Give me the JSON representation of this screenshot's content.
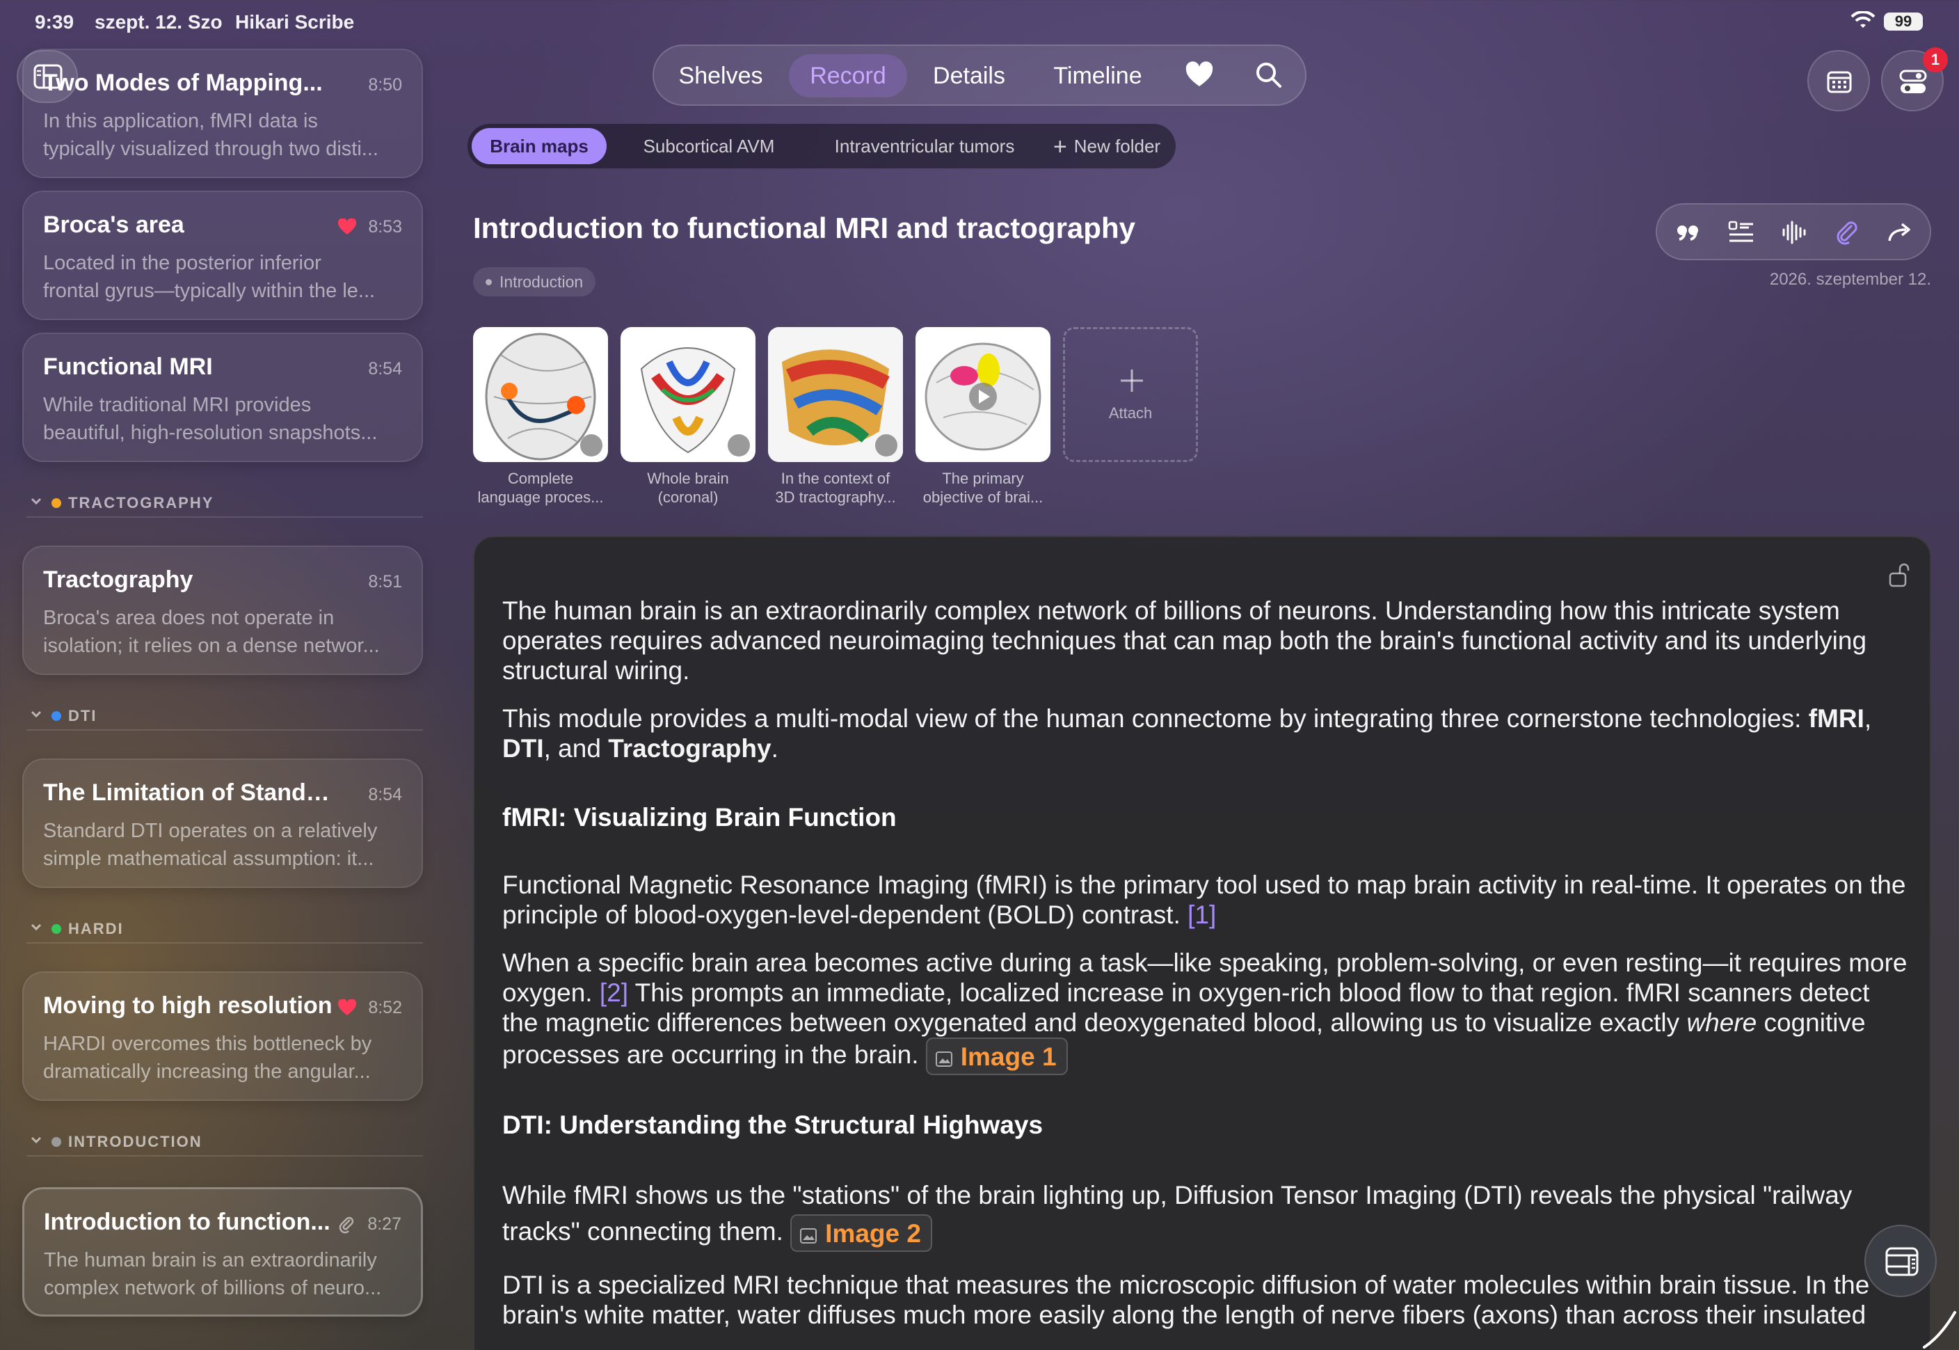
{
  "status": {
    "time": "9:39",
    "date": "szept. 12. Szo",
    "app": "Hikari Scribe",
    "battery": "99"
  },
  "nav": {
    "tabs": [
      "Shelves",
      "Record",
      "Details",
      "Timeline"
    ],
    "active_tab": "Record",
    "notification_count": "1"
  },
  "folders": {
    "items": [
      "Brain maps",
      "Subcortical AVM",
      "Intraventricular tumors"
    ],
    "active": "Brain maps",
    "new_folder": "New folder"
  },
  "sidebar": {
    "cards": [
      {
        "title": "Two Modes of Mapping...",
        "time": "8:50",
        "line1": "In this application, fMRI data is",
        "line2": "typically visualized through two disti...",
        "favorite": false
      },
      {
        "title": "Broca's area",
        "time": "8:53",
        "line1": "Located in the posterior inferior",
        "line2": "frontal gyrus—typically within the le...",
        "favorite": true
      },
      {
        "title": "Functional MRI",
        "time": "8:54",
        "line1": "While traditional MRI provides",
        "line2": "beautiful, high-resolution snapshots...",
        "favorite": false
      },
      {
        "title": "Tractography",
        "time": "8:51",
        "line1": "Broca's area does not operate in",
        "line2": "isolation; it relies on a dense networ...",
        "favorite": false
      },
      {
        "title": "The Limitation of Standar...",
        "time": "8:54",
        "line1": "Standard DTI operates on a relatively",
        "line2": "simple mathematical assumption: it...",
        "favorite": false
      },
      {
        "title": "Moving to high resolution",
        "time": "8:52",
        "line1": "HARDI overcomes this bottleneck by",
        "line2": "dramatically increasing the angular...",
        "favorite": true
      },
      {
        "title": "Introduction to function...",
        "time": "8:27",
        "line1": "The human brain is an extraordinarily",
        "line2": "complex network of billions of neuro...",
        "favorite": false,
        "attachment": true
      }
    ],
    "sections": [
      {
        "label": "TRACTOGRAPHY",
        "color": "#f5a623"
      },
      {
        "label": "DTI",
        "color": "#3b8cf5"
      },
      {
        "label": "HARDI",
        "color": "#34c759"
      },
      {
        "label": "INTRODUCTION",
        "color": "#9a9a9a"
      }
    ]
  },
  "note": {
    "title": "Introduction to functional MRI and tractography",
    "tag": "Introduction",
    "date": "2026. szeptember 12.",
    "attachments": [
      {
        "cap1": "Complete",
        "cap2": "language proces..."
      },
      {
        "cap1": "Whole brain",
        "cap2": "(coronal)"
      },
      {
        "cap1": "In the context of",
        "cap2": "3D tractography..."
      },
      {
        "cap1": "The primary",
        "cap2": "objective of brai..."
      }
    ],
    "attach_label": "Attach",
    "body": {
      "p1": "The human brain is an extraordinarily complex network of billions of neurons. Understanding how this intricate system operates requires advanced neuroimaging techniques that can map both the brain's functional activity and its underlying structural wiring.",
      "p2_a": "This module provides a multi-modal view of the human connectome by integrating three cornerstone technologies: ",
      "p2_b1": "fMRI",
      "p2_c": ", ",
      "p2_b2": "DTI",
      "p2_d": ", and ",
      "p2_b3": "Tractography",
      "p2_e": ".",
      "h1": "fMRI: Visualizing Brain Function",
      "p3": "Functional Magnetic Resonance Imaging (fMRI) is the primary tool used to map brain activity in real-time. It operates on the principle of blood-oxygen-level-dependent (BOLD) contrast. ",
      "ref1": "[1]",
      "p4_a": "When a specific brain area becomes active during a task—like speaking, problem-solving, or even resting—it requires more oxygen. ",
      "ref2": "[2]",
      "p4_b": " This prompts an immediate, localized increase in oxygen-rich blood flow to that region. fMRI scanners detect the magnetic differences between oxygenated and deoxygenated blood, allowing us to visualize exactly ",
      "p4_em": "where",
      "p4_c": " cognitive processes are occurring in the brain. ",
      "img1": "Image 1",
      "h2": "DTI: Understanding the Structural Highways",
      "p5": "While fMRI shows us the \"stations\" of the brain lighting up, Diffusion Tensor Imaging (DTI) reveals the physical \"railway tracks\" connecting them. ",
      "img2": "Image 2",
      "p6": "DTI is a specialized MRI technique that measures the microscopic diffusion of water molecules within brain tissue. In the brain's white matter, water diffuses much more easily along the length of nerve fibers (axons) than across their insulated"
    }
  },
  "colors": {
    "accent": "#a78bfa",
    "image_chip": "#ff9a3c",
    "heart": "#ff3b5c",
    "badge": "#e8243a"
  }
}
